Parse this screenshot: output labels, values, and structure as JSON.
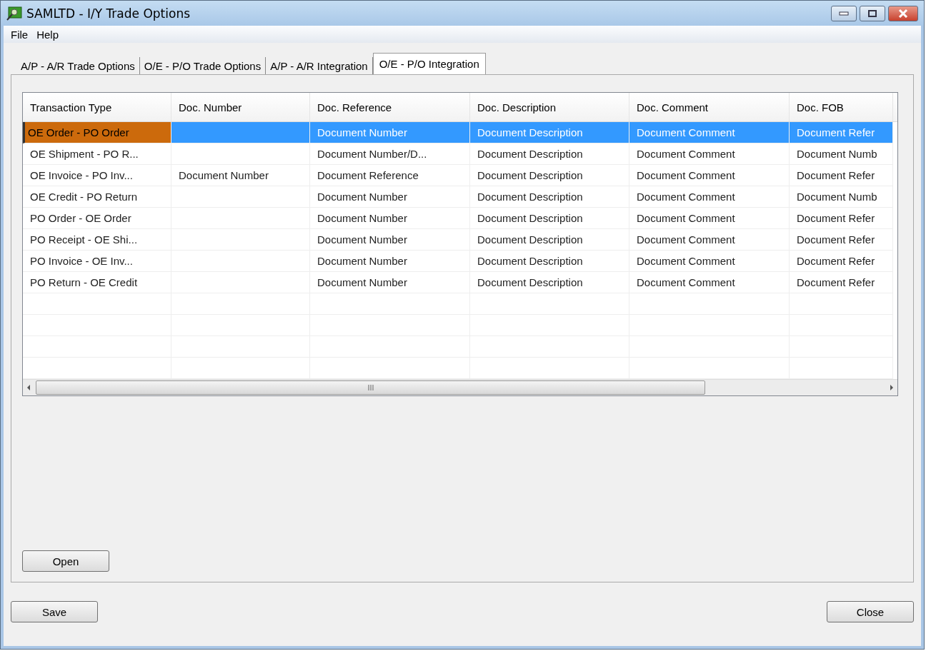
{
  "window": {
    "title": "SAMLTD - I/Y Trade Options"
  },
  "menu": [
    "File",
    "Help"
  ],
  "tabs": [
    {
      "label": "A/P - A/R Trade Options",
      "selected": false
    },
    {
      "label": "O/E - P/O Trade Options",
      "selected": false
    },
    {
      "label": "A/P - A/R Integration",
      "selected": false
    },
    {
      "label": "O/E - P/O Integration",
      "selected": true
    }
  ],
  "table": {
    "columns": [
      "Transaction Type",
      "Doc. Number",
      "Doc. Reference",
      "Doc. Description",
      "Doc. Comment",
      "Doc. FOB"
    ],
    "rows": [
      {
        "selected": true,
        "cells": [
          "OE Order - PO Order",
          null,
          "Document Number",
          "Document Description",
          "Document Comment",
          "Document Refer"
        ]
      },
      {
        "selected": false,
        "cells": [
          "OE Shipment - PO R...",
          null,
          "Document Number/D...",
          "Document Description",
          "Document Comment",
          "Document Numb"
        ]
      },
      {
        "selected": false,
        "cells": [
          "OE Invoice - PO Inv...",
          "Document Number",
          "Document Reference",
          "Document Description",
          "Document Comment",
          "Document Refer"
        ]
      },
      {
        "selected": false,
        "cells": [
          "OE Credit - PO Return",
          null,
          "Document Number",
          "Document Description",
          "Document Comment",
          "Document Numb"
        ]
      },
      {
        "selected": false,
        "cells": [
          "PO Order - OE Order",
          null,
          "Document Number",
          "Document Description",
          "Document Comment",
          "Document Refer"
        ]
      },
      {
        "selected": false,
        "cells": [
          "PO Receipt - OE Shi...",
          null,
          "Document Number",
          "Document Description",
          "Document Comment",
          "Document Refer"
        ]
      },
      {
        "selected": false,
        "cells": [
          "PO Invoice - OE Inv...",
          null,
          "Document Number",
          "Document Description",
          "Document Comment",
          "Document Refer"
        ]
      },
      {
        "selected": false,
        "cells": [
          "PO Return - OE Credit",
          null,
          "Document Number",
          "Document Description",
          "Document Comment",
          "Document Refer"
        ]
      }
    ]
  },
  "panel_buttons": [
    "Open"
  ],
  "footer_buttons": [
    "Save",
    "Close"
  ]
}
